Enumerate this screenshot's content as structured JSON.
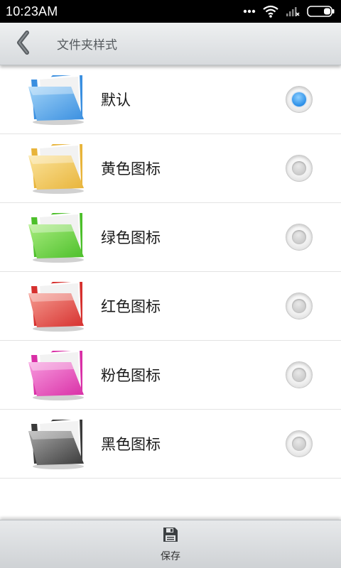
{
  "status_bar": {
    "time": "10:23AM",
    "icons": [
      "more-dots-icon",
      "wifi-icon",
      "signal-icon",
      "battery-icon"
    ]
  },
  "header": {
    "title": "文件夹样式",
    "back_icon": "chevron-left-icon"
  },
  "folder_styles": [
    {
      "label": "默认",
      "color": "#3a8fe0",
      "light": "#9fd2f7",
      "selected": true
    },
    {
      "label": "黄色图标",
      "color": "#e8b43a",
      "light": "#fbe39a",
      "selected": false
    },
    {
      "label": "绿色图标",
      "color": "#4cbf2a",
      "light": "#a8ec7e",
      "selected": false
    },
    {
      "label": "红色图标",
      "color": "#d6302e",
      "light": "#f59a8f",
      "selected": false
    },
    {
      "label": "粉色图标",
      "color": "#d92fa6",
      "light": "#f79ade",
      "selected": false
    },
    {
      "label": "黑色图标",
      "color": "#3a3a3a",
      "light": "#a7a7a7",
      "selected": false
    }
  ],
  "footer": {
    "save_label": "保存",
    "save_icon": "floppy-disk-icon"
  }
}
